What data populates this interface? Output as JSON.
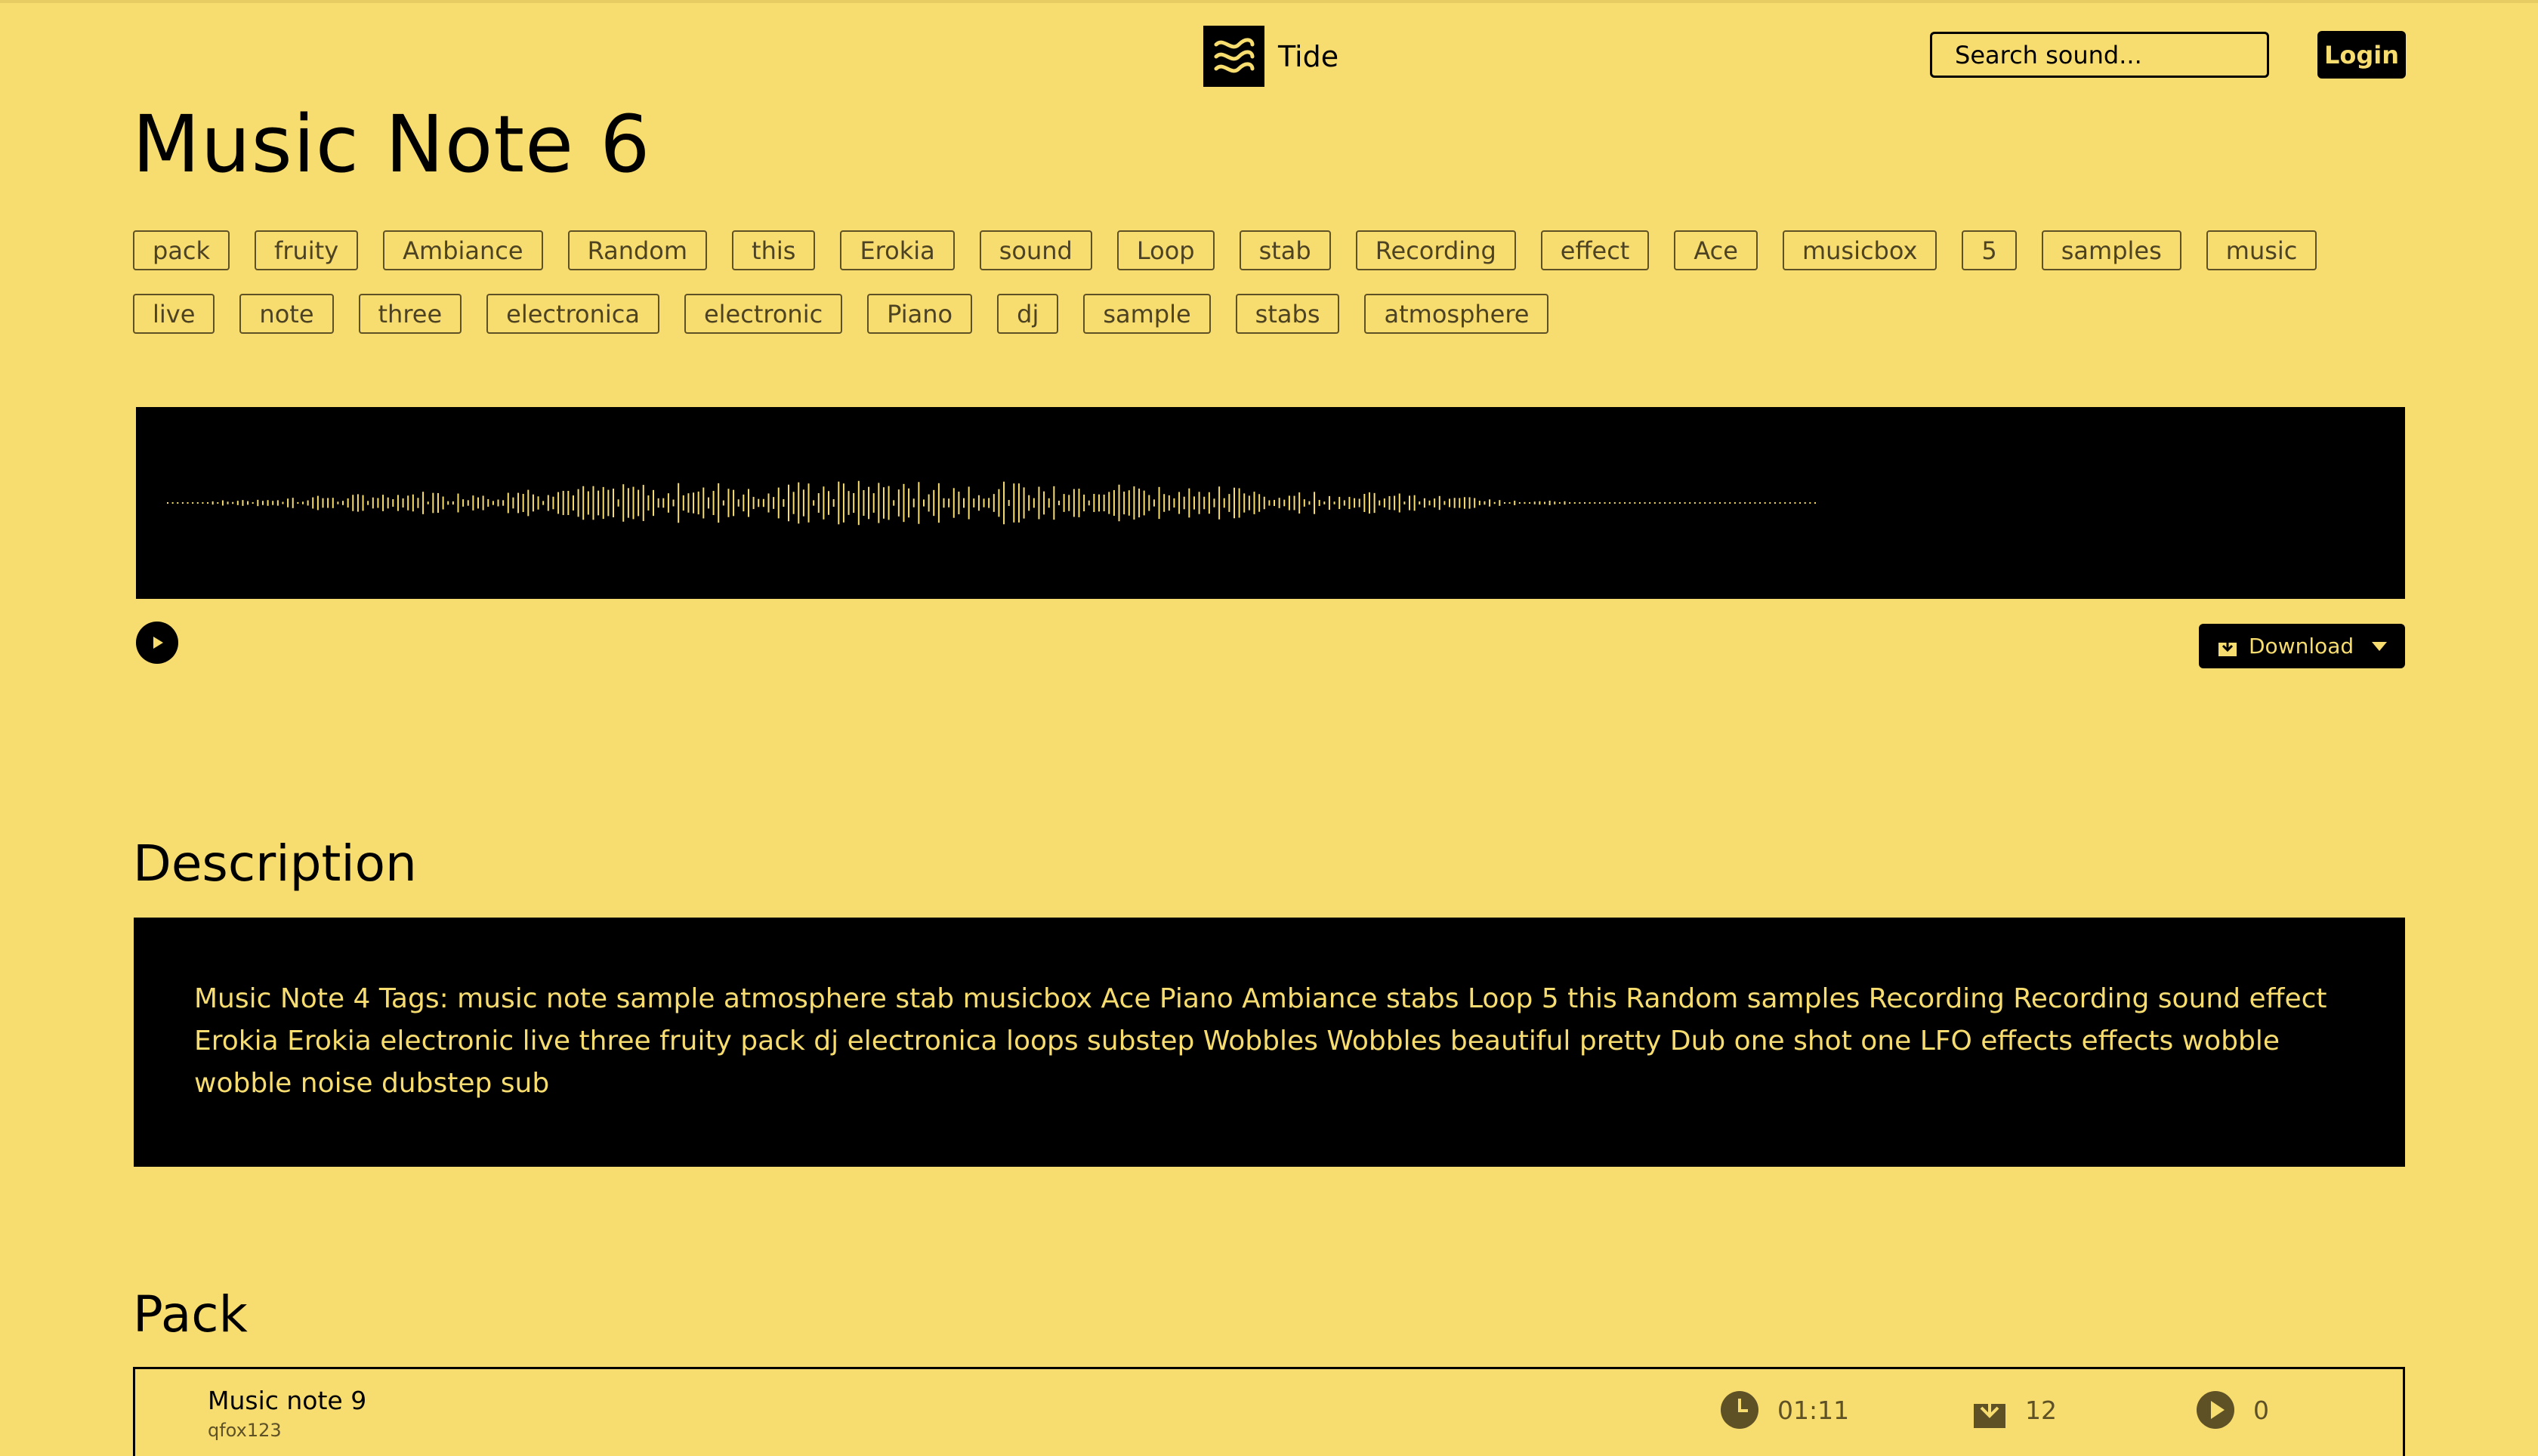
{
  "header": {
    "brand": "Tide",
    "search_placeholder": "Search sound...",
    "login_label": "Login"
  },
  "title": "Music Note 6",
  "tags": [
    "pack",
    "fruity",
    "Ambiance",
    "Random",
    "this",
    "Erokia",
    "sound",
    "Loop",
    "stab",
    "Recording",
    "effect",
    "Ace",
    "musicbox",
    "5",
    "samples",
    "music",
    "live",
    "note",
    "three",
    "electronica",
    "electronic",
    "Piano",
    "dj",
    "sample",
    "stabs",
    "atmosphere"
  ],
  "player": {
    "download_label": "Download",
    "waveform_color": "#f7dc6f",
    "waveform_played_fraction": 0.74
  },
  "description": {
    "heading": "Description",
    "text": "Music Note 4 Tags: music note sample atmosphere stab musicbox Ace Piano Ambiance stabs Loop 5 this Random samples Recording Recording sound effect Erokia Erokia electronic live three fruity pack dj electronica loops substep Wobbles Wobbles beautiful pretty Dub one shot one LFO effects effects wobble wobble noise dubstep sub"
  },
  "pack": {
    "heading": "Pack",
    "items": [
      {
        "name": "Music note 9",
        "user": "qfox123",
        "duration": "01:11",
        "downloads": "12",
        "plays": "0"
      }
    ]
  },
  "colors": {
    "background": "#f7dc6f",
    "ink": "#000000",
    "muted": "#5e5126"
  }
}
